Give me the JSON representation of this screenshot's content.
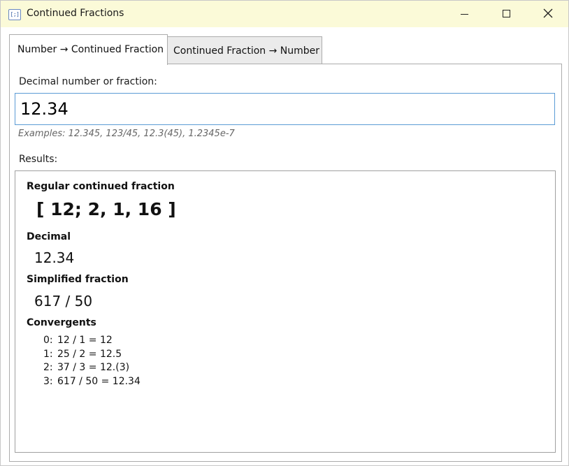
{
  "window": {
    "title": "Continued Fractions",
    "icon": "continued-fraction-app-icon",
    "icon_text": "[;]"
  },
  "tabs": [
    {
      "label": "Number → Continued Fraction",
      "active": true
    },
    {
      "label": "Continued Fraction → Number",
      "active": false
    }
  ],
  "input": {
    "label": "Decimal number or fraction:",
    "value": "12.34",
    "examples": "Examples: 12.345, 123/45, 12.3(45), 1.2345e-7"
  },
  "results": {
    "label": "Results:",
    "regular_cf_heading": "Regular continued fraction",
    "regular_cf_value": "[ 12; 2, 1, 16 ]",
    "decimal_heading": "Decimal",
    "decimal_value": "12.34",
    "fraction_heading": "Simplified fraction",
    "fraction_value": "617 / 50",
    "convergents_heading": "Convergents",
    "convergents": [
      {
        "index": "0:",
        "text": "12 / 1 = 12"
      },
      {
        "index": "1:",
        "text": "25 / 2 = 12.5"
      },
      {
        "index": "2:",
        "text": "37 / 3 = 12.(3)"
      },
      {
        "index": "3:",
        "text": "617 / 50 = 12.34"
      }
    ]
  },
  "colors": {
    "titlebar": "#fbfad8",
    "input_border": "#5b9bd5"
  }
}
